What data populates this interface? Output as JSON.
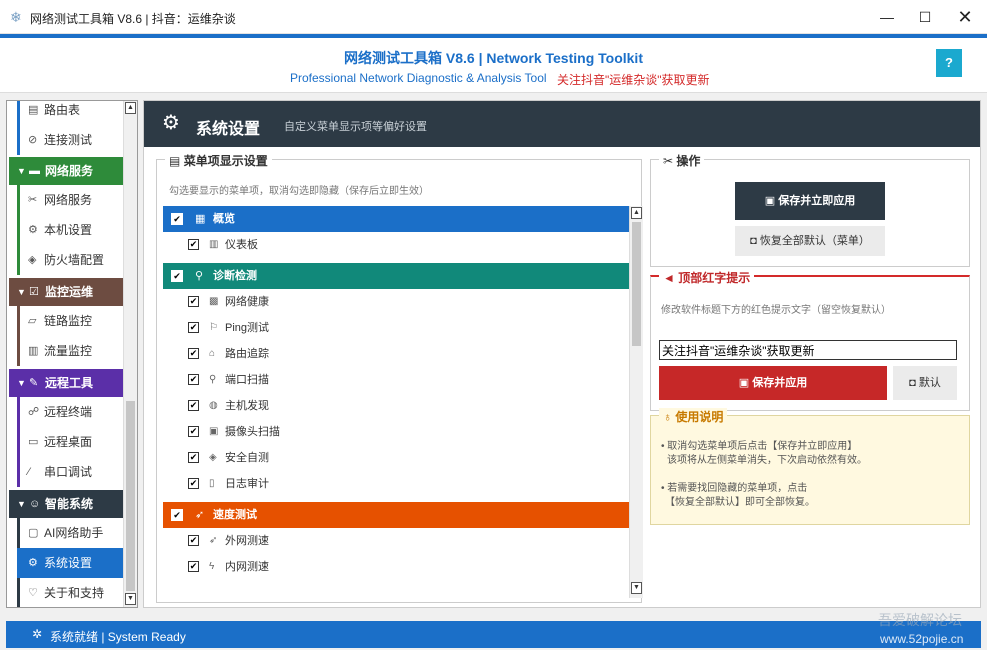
{
  "window": {
    "title": "网络测试工具箱 V8.6 | 抖音：运维杂谈",
    "minimize": "—",
    "maximize": "☐",
    "close": "✕"
  },
  "header": {
    "title": "网络测试工具箱 V8.6 | Network Testing Toolkit",
    "subtitle": "Professional Network Diagnostic & Analysis Tool",
    "promo": "关注抖音\"运维杂谈\"获取更新",
    "help": "?"
  },
  "colors": {
    "accent": "#1b6fc8",
    "dark": "#2d3a45",
    "network_green": "#2e8b3a",
    "monitor_brown": "#6d4c41",
    "remote_purple": "#5b2fa8",
    "smart_dark": "#2d3a45",
    "cat_overview": "#1b6fc8",
    "cat_diag": "#11897a",
    "cat_speed": "#e65100",
    "red": "#c62828"
  },
  "sidebar": {
    "items": [
      {
        "label": "路由表",
        "icon": "doc-icon"
      },
      {
        "label": "连接测试",
        "icon": "link-icon"
      }
    ],
    "sections": [
      {
        "label": "网络服务",
        "icon": "monitor-icon",
        "items": [
          {
            "label": "网络服务",
            "icon": "tools-icon"
          },
          {
            "label": "本机设置",
            "icon": "gear-icon"
          },
          {
            "label": "防火墙配置",
            "icon": "shield-icon"
          }
        ]
      },
      {
        "label": "监控运维",
        "icon": "check-icon",
        "items": [
          {
            "label": "链路监控",
            "icon": "chart-icon"
          },
          {
            "label": "流量监控",
            "icon": "bars-icon"
          }
        ]
      },
      {
        "label": "远程工具",
        "icon": "pin-icon",
        "items": [
          {
            "label": "远程终端",
            "icon": "terminal-icon"
          },
          {
            "label": "远程桌面",
            "icon": "desktop-icon"
          },
          {
            "label": "串口调试",
            "icon": "pen-icon"
          }
        ]
      },
      {
        "label": "智能系统",
        "icon": "robot-icon",
        "items": [
          {
            "label": "AI网络助手",
            "icon": "chat-icon"
          },
          {
            "label": "系统设置",
            "icon": "gear-icon"
          },
          {
            "label": "关于和支持",
            "icon": "heart-icon"
          }
        ]
      }
    ]
  },
  "main": {
    "title": "系统设置",
    "description": "自定义菜单显示项等偏好设置"
  },
  "menu_settings": {
    "legend": "菜单项显示设置",
    "hint": "勾选要显示的菜单项，取消勾选即隐藏（保存后立即生效）",
    "categories": [
      {
        "label": "概览",
        "checked": "✔",
        "items": [
          {
            "label": "仪表板",
            "checked": "✔"
          }
        ]
      },
      {
        "label": "诊断检测",
        "checked": "✔",
        "items": [
          {
            "label": "网络健康",
            "checked": "✔"
          },
          {
            "label": "Ping测试",
            "checked": "✔"
          },
          {
            "label": "路由追踪",
            "checked": "✔"
          },
          {
            "label": "端口扫描",
            "checked": "✔"
          },
          {
            "label": "主机发现",
            "checked": "✔"
          },
          {
            "label": "摄像头扫描",
            "checked": "✔"
          },
          {
            "label": "安全自测",
            "checked": "✔"
          },
          {
            "label": "日志审计",
            "checked": "✔"
          }
        ]
      },
      {
        "label": "速度测试",
        "checked": "✔",
        "items": [
          {
            "label": "外网测速",
            "checked": "✔"
          },
          {
            "label": "内网测速",
            "checked": "✔"
          }
        ]
      }
    ]
  },
  "actions": {
    "legend": "操作",
    "save_apply": "保存并立即应用",
    "restore_all": "恢复全部默认（菜单）"
  },
  "red_tip": {
    "legend": "顶部红字提示",
    "description": "修改软件标题下方的红色提示文字（留空恢复默认）",
    "value": "关注抖音\"运维杂谈\"获取更新",
    "save": "保存并应用",
    "default": "默认"
  },
  "usage": {
    "legend": "使用说明",
    "line1": "• 取消勾选菜单项后点击【保存并立即应用】",
    "line2": "该项将从左侧菜单消失，下次启动依然有效。",
    "line3": "• 若需要找回隐藏的菜单项，点击",
    "line4": "【恢复全部默认】即可全部恢复。"
  },
  "status": {
    "text": "系统就绪 | System Ready"
  },
  "watermark": {
    "line1": "吾爱破解论坛",
    "line2": "www.52pojie.cn"
  }
}
